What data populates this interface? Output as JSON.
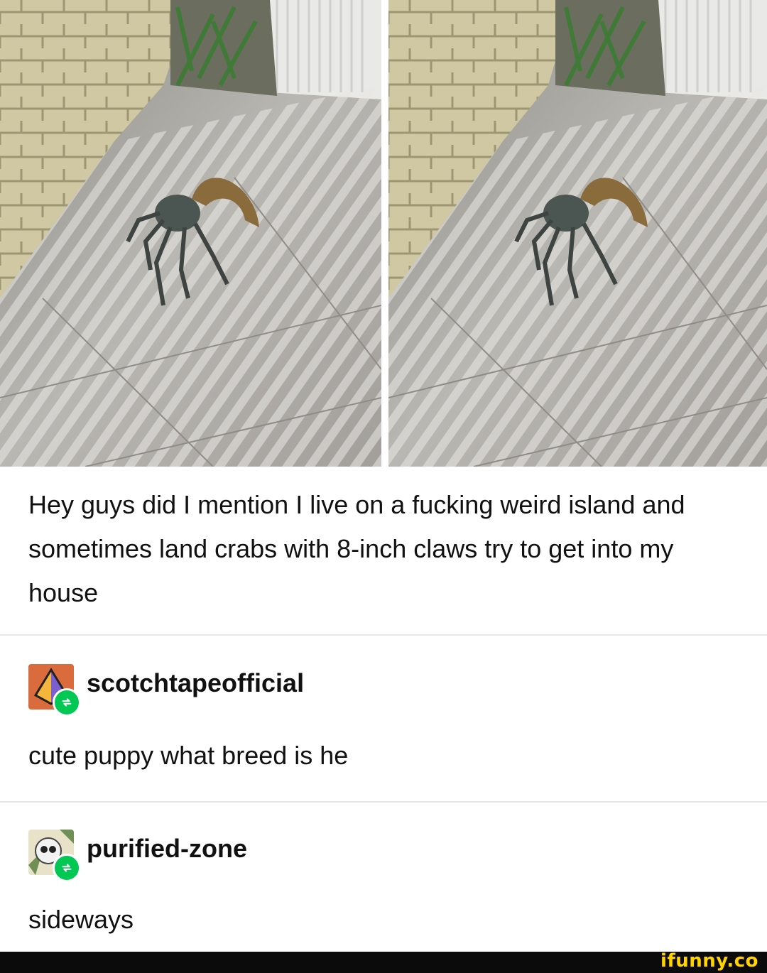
{
  "post": {
    "text": "Hey guys did I mention I live on a fucking weird island and sometimes land crabs with 8-inch claws try to get into my house"
  },
  "reblogs": [
    {
      "username": "scotchtapeofficial",
      "reply": "cute puppy what breed is he",
      "avatar_icon": "pyramid-avatar-icon"
    },
    {
      "username": "purified-zone",
      "reply": "sideways",
      "avatar_icon": "skull-avatar-icon"
    }
  ],
  "watermark": {
    "text": "ifunny.co"
  },
  "colors": {
    "reblog_badge": "#00c853",
    "watermark": "#ffd200",
    "footer_bar": "#0b0b0b"
  }
}
